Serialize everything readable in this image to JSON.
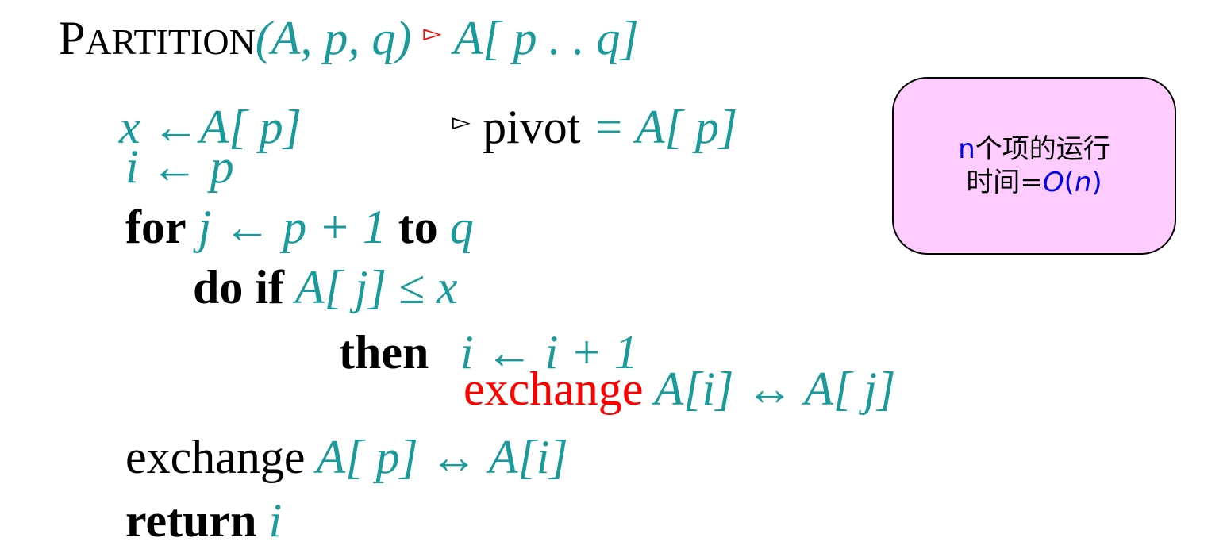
{
  "header": {
    "name_first": "P",
    "name_rest": "ARTITION",
    "params": "(A, p, q)",
    "comment_marker": "▻",
    "comment": "A[ p . . q]"
  },
  "lines": {
    "x_assign": "x ←A[ p]",
    "pivot_marker": "▻",
    "pivot_word": "pivot",
    "pivot_expr": " = A[ p]",
    "i_assign": "i ← p",
    "for_kw": "for",
    "for_expr": " j ← p + 1 ",
    "to_kw": "to",
    "to_expr": " q",
    "doif_kw": "do if",
    "doif_expr": " A[ j] ≤ x",
    "then_kw": "then",
    "then_expr": "i ← i + 1",
    "exch1_word": "exchange",
    "exch1_expr": " A[i] ↔ A[ j]",
    "exch2_word": "exchange",
    "exch2_expr": " A[ p] ↔ A[i]",
    "return_kw": "return",
    "return_expr": " i"
  },
  "note": {
    "n1": "n",
    "line1_rest": "个项的运行",
    "line2_prefix": "时间=",
    "big_o": "O",
    "open_paren": "(",
    "n2": "n",
    "close_paren": ")"
  }
}
